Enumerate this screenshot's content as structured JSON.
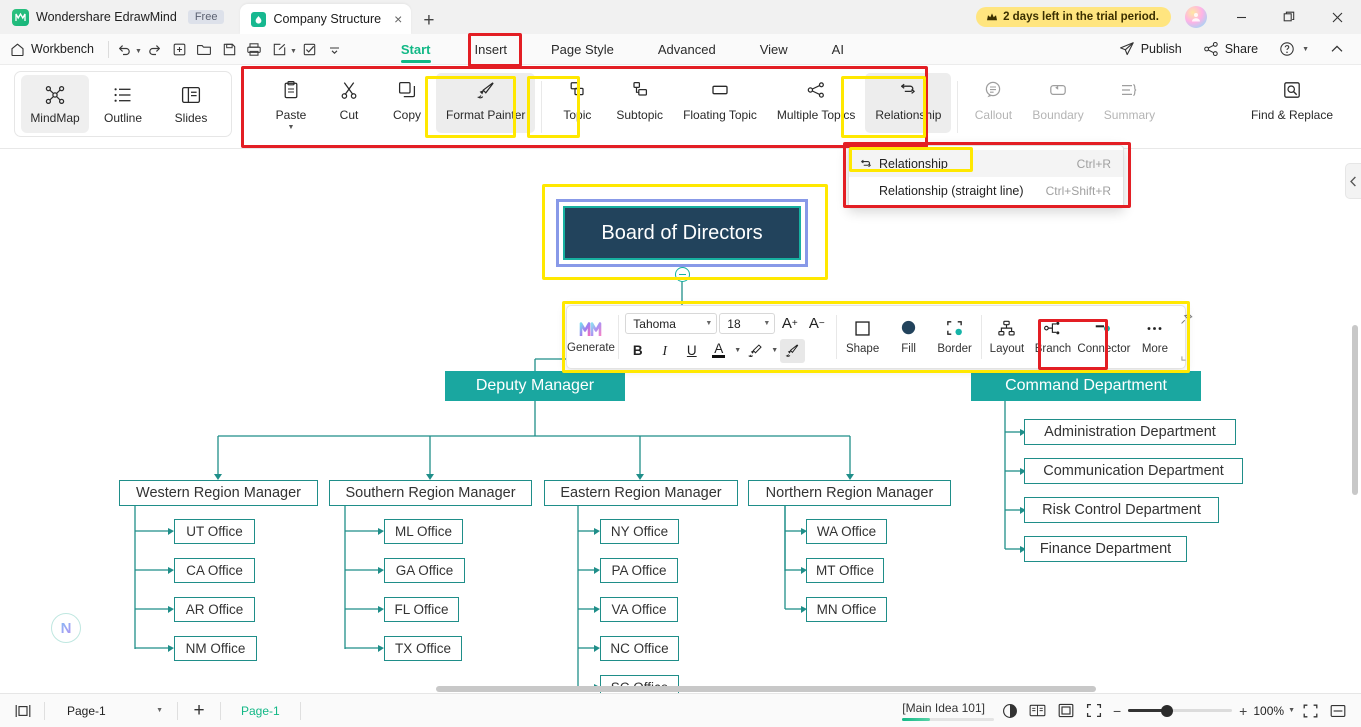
{
  "titlebar": {
    "brand": "Wondershare EdrawMind",
    "free_badge": "Free",
    "doc_tab_title": "Company Structure",
    "close_tab": "×",
    "new_tab": "+",
    "trial_text": "2 days left in the trial period.",
    "minimize": "minimize-icon",
    "maximize": "maximize-icon",
    "close": "close-icon"
  },
  "menubar": {
    "workbench": "Workbench",
    "tabs": [
      {
        "label": "Start",
        "active": true
      },
      {
        "label": "Insert",
        "active": false
      },
      {
        "label": "Page Style",
        "active": false
      },
      {
        "label": "Advanced",
        "active": false
      },
      {
        "label": "View",
        "active": false
      },
      {
        "label": "AI",
        "active": false
      }
    ],
    "right": [
      {
        "label": "Publish",
        "icon": "publish-icon"
      },
      {
        "label": "Share",
        "icon": "share-icon"
      },
      {
        "label": "",
        "icon": "help-icon"
      },
      {
        "label": "",
        "icon": "collapse-ribbon-icon"
      }
    ]
  },
  "ribbon": {
    "views": [
      {
        "label": "MindMap",
        "selected": true
      },
      {
        "label": "Outline",
        "selected": false
      },
      {
        "label": "Slides",
        "selected": false
      }
    ],
    "items": [
      {
        "label": "Paste",
        "state": "normal",
        "has_caret": true
      },
      {
        "label": "Cut",
        "state": "normal",
        "has_caret": false
      },
      {
        "label": "Copy",
        "state": "normal",
        "has_caret": false
      },
      {
        "label": "Format Painter",
        "state": "selected",
        "has_caret": false
      },
      {
        "label": "Topic",
        "state": "normal",
        "has_caret": false
      },
      {
        "label": "Subtopic",
        "state": "normal",
        "has_caret": false
      },
      {
        "label": "Floating Topic",
        "state": "normal",
        "has_caret": false
      },
      {
        "label": "Multiple Topics",
        "state": "normal",
        "has_caret": false
      },
      {
        "label": "Relationship",
        "state": "selected",
        "has_caret": false
      },
      {
        "label": "Callout",
        "state": "disabled",
        "has_caret": false
      },
      {
        "label": "Boundary",
        "state": "disabled",
        "has_caret": false
      },
      {
        "label": "Summary",
        "state": "disabled",
        "has_caret": false
      }
    ],
    "find_replace": "Find & Replace"
  },
  "dropdown": {
    "items": [
      {
        "label": "Relationship",
        "shortcut": "Ctrl+R",
        "highlighted": true,
        "icon": "relationship-icon"
      },
      {
        "label": "Relationship (straight line)",
        "shortcut": "Ctrl+Shift+R",
        "highlighted": false,
        "icon": ""
      }
    ]
  },
  "format_toolbar": {
    "generate": "Generate",
    "font_family": "Tahoma",
    "font_size": "18",
    "increase_font": "A",
    "decrease_font": "A",
    "bold": "B",
    "italic": "I",
    "underline": "U",
    "font_color": "A",
    "highlight": "highlighter-icon",
    "format_painter": "format-painter-icon",
    "shape": "Shape",
    "fill": "Fill",
    "border": "Border",
    "layout": "Layout",
    "branch": "Branch",
    "connector": "Connector",
    "more": "More",
    "pin": "pin-icon"
  },
  "mindmap": {
    "root": "Board of Directors",
    "level1": [
      {
        "label": "Deputy Manager"
      },
      {
        "label": "Command Department"
      }
    ],
    "deputy_children": [
      {
        "label": "Western Region Manager",
        "offices": [
          "UT Office",
          "CA Office",
          "AR Office",
          "NM Office"
        ]
      },
      {
        "label": "Southern Region Manager",
        "offices": [
          "ML Office",
          "GA Office",
          "FL Office",
          "TX Office"
        ]
      },
      {
        "label": "Eastern Region Manager",
        "offices": [
          "NY Office",
          "PA Office",
          "VA Office",
          "NC Office",
          "SC Office"
        ]
      },
      {
        "label": "Northern Region Manager",
        "offices": [
          "WA Office",
          "MT Office",
          "MN Office"
        ]
      }
    ],
    "command_children": [
      "Administration Department",
      "Communication Department",
      "Risk Control Department",
      "Finance Department"
    ]
  },
  "statusbar": {
    "sidebar_toggle": "sidebar-toggle-icon",
    "page_select": "Page-1",
    "add_page": "+",
    "page_tag": "Page-1",
    "main_idea": "[Main Idea 101]",
    "zoom_level": "100%",
    "zoom_minus": "−",
    "zoom_plus": "+",
    "icons": [
      "theme-icon",
      "slides-view-icon",
      "fit-page-icon",
      "fullscreen-canvas-icon",
      "presentation-icon",
      "split-view-icon"
    ]
  },
  "colors": {
    "accent_green": "#12b886",
    "teal": "#1aa7a0",
    "root_fill": "#22435c",
    "highlight_red": "#e31e24",
    "highlight_yellow": "#ffe800",
    "trial_yellow": "#ffe57f"
  }
}
